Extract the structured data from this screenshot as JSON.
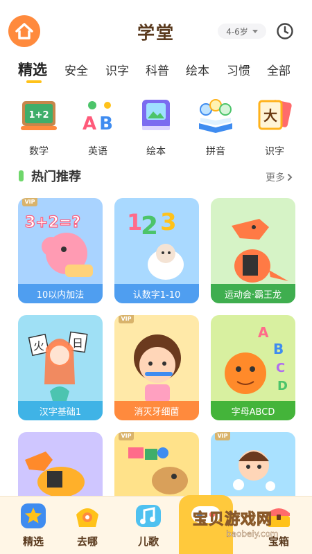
{
  "header": {
    "title": "学堂",
    "age_filter": "4-6岁",
    "home_icon": "home-icon",
    "history_icon": "clock-icon"
  },
  "tabs": [
    {
      "label": "精选",
      "active": true
    },
    {
      "label": "安全"
    },
    {
      "label": "识字"
    },
    {
      "label": "科普"
    },
    {
      "label": "绘本"
    },
    {
      "label": "习惯"
    },
    {
      "label": "全部"
    }
  ],
  "categories": [
    {
      "label": "数学",
      "icon": "math-board-icon"
    },
    {
      "label": "英语",
      "icon": "abc-letters-icon"
    },
    {
      "label": "绘本",
      "icon": "picture-book-icon"
    },
    {
      "label": "拼音",
      "icon": "pinyin-book-icon"
    },
    {
      "label": "识字",
      "icon": "character-card-icon"
    }
  ],
  "section": {
    "title": "热门推荐",
    "more_label": "更多"
  },
  "cards": [
    {
      "title": "10以内加法",
      "vip": true,
      "art_text": "3+2=?"
    },
    {
      "title": "认数字1-10",
      "vip": false,
      "art_text": "123"
    },
    {
      "title": "运动会·霸王龙",
      "vip": false
    },
    {
      "title": "汉字基础1",
      "vip": false,
      "art_text": [
        "火",
        "日"
      ]
    },
    {
      "title": "消灭牙细菌",
      "vip": true
    },
    {
      "title": "字母ABCD",
      "vip": false,
      "art_text": [
        "A",
        "B",
        "C",
        "D"
      ]
    },
    {
      "title": "",
      "vip": false
    },
    {
      "title": "",
      "vip": true
    },
    {
      "title": "",
      "vip": true
    }
  ],
  "vip_label": "VIP",
  "bottom_nav": [
    {
      "label": "精选",
      "icon": "star-badge-icon"
    },
    {
      "label": "去哪",
      "icon": "explore-icon"
    },
    {
      "label": "儿歌",
      "icon": "music-note-icon"
    },
    {
      "label": "宝箱",
      "icon": "treasure-chest-icon"
    }
  ],
  "watermark": {
    "text": "宝贝游戏网",
    "url": "baobeiy.com"
  },
  "colors": {
    "accent": "#ffc21a",
    "home_button": "#ff8a3d",
    "section_bar": "#6fd76b",
    "nav_bg": "#fff6e6"
  }
}
